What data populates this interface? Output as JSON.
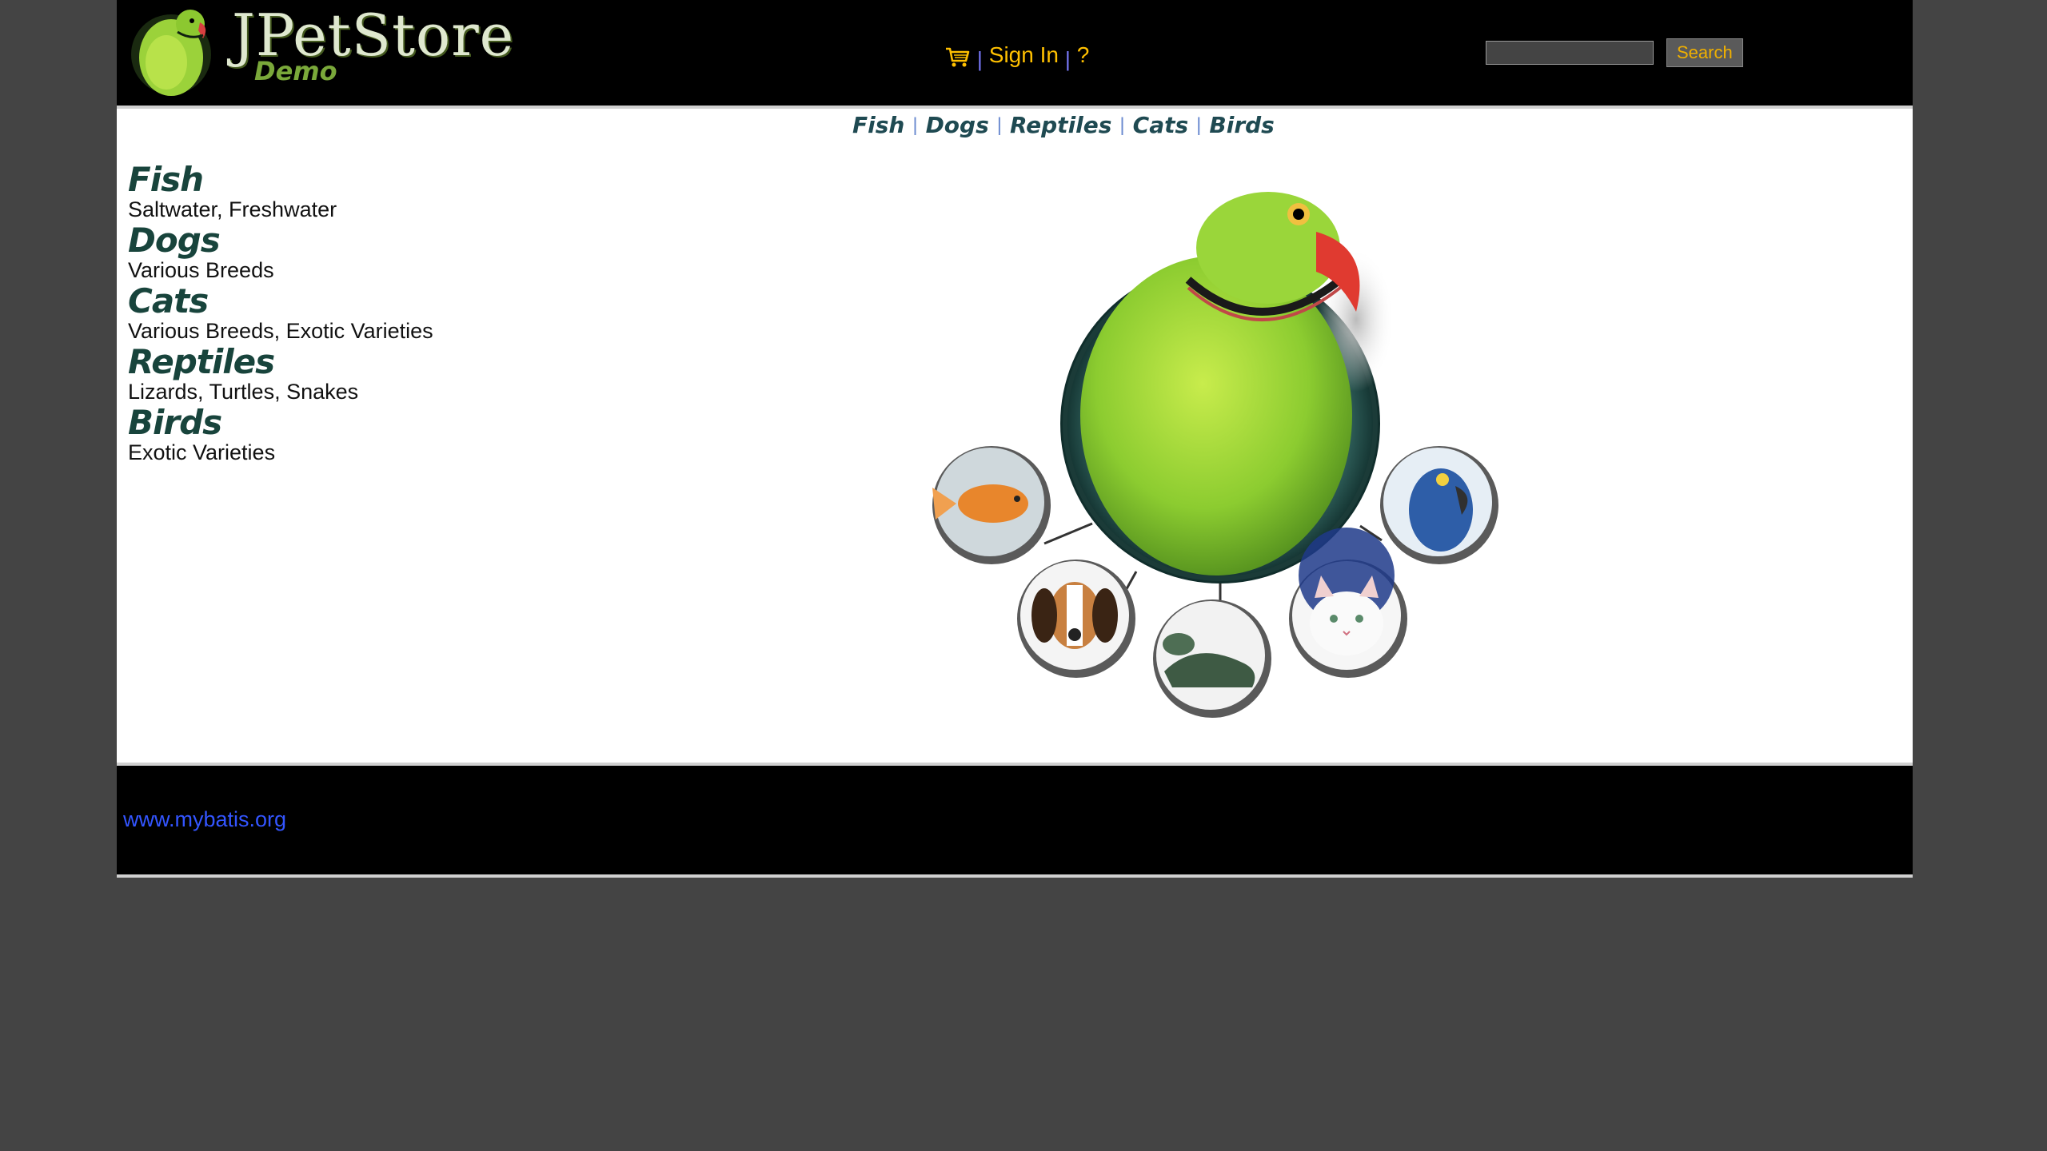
{
  "header": {
    "logo_title": "JPetStore",
    "logo_subtitle": "Demo",
    "menu": {
      "sep": "|",
      "signin": "Sign In",
      "help": "?"
    },
    "search": {
      "value": "",
      "button": "Search"
    }
  },
  "quicklinks": [
    "Fish",
    "Dogs",
    "Reptiles",
    "Cats",
    "Birds"
  ],
  "sidebar": {
    "categories": [
      {
        "name": "Fish",
        "desc": "Saltwater, Freshwater"
      },
      {
        "name": "Dogs",
        "desc": "Various Breeds"
      },
      {
        "name": "Cats",
        "desc": "Various Breeds, Exotic Varieties"
      },
      {
        "name": "Reptiles",
        "desc": "Lizards, Turtles, Snakes"
      },
      {
        "name": "Birds",
        "desc": "Exotic Varieties"
      }
    ]
  },
  "footer": {
    "link": "www.mybatis.org"
  },
  "colors": {
    "header_bg": "#000000",
    "menu_link": "#ffc000",
    "category_title": "#18443c",
    "footer_link": "#3355ff",
    "page_bg": "#444444"
  }
}
